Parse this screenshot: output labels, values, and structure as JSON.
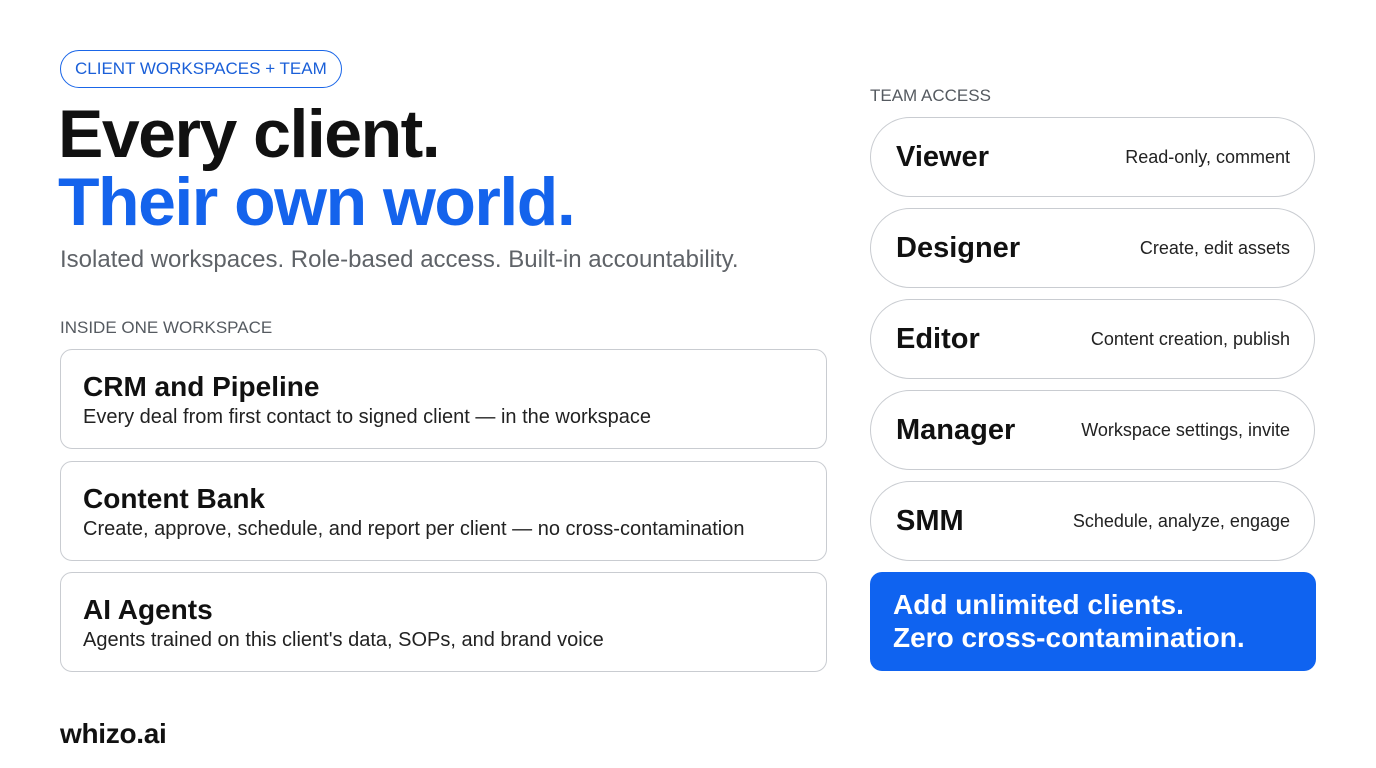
{
  "badge": "CLIENT WORKSPACES + TEAM",
  "headline": {
    "line1": "Every client.",
    "line2": "Their own world."
  },
  "subhead": "Isolated workspaces. Role-based access. Built-in accountability.",
  "inside_label": "INSIDE ONE WORKSPACE",
  "features": [
    {
      "title": "CRM and Pipeline",
      "desc": "Every deal from first contact to signed client — in the workspace"
    },
    {
      "title": "Content Bank",
      "desc": "Create, approve, schedule, and report per client — no cross-contamination"
    },
    {
      "title": "AI Agents",
      "desc": "Agents trained on this client's data, SOPs, and brand voice"
    }
  ],
  "team_label": "TEAM ACCESS",
  "roles": [
    {
      "name": "Viewer",
      "desc": "Read-only, comment"
    },
    {
      "name": "Designer",
      "desc": "Create, edit assets"
    },
    {
      "name": "Editor",
      "desc": "Content creation, publish"
    },
    {
      "name": "Manager",
      "desc": "Workspace settings, invite"
    },
    {
      "name": "SMM",
      "desc": "Schedule, analyze, engage"
    }
  ],
  "cta": {
    "line1": "Add unlimited clients.",
    "line2": "Zero cross-contamination."
  },
  "brand": "whizo.ai",
  "colors": {
    "accent": "#1463ec",
    "cta_bg": "#0f63f0",
    "border": "#c9ccd1",
    "muted_text": "#5f6368"
  }
}
